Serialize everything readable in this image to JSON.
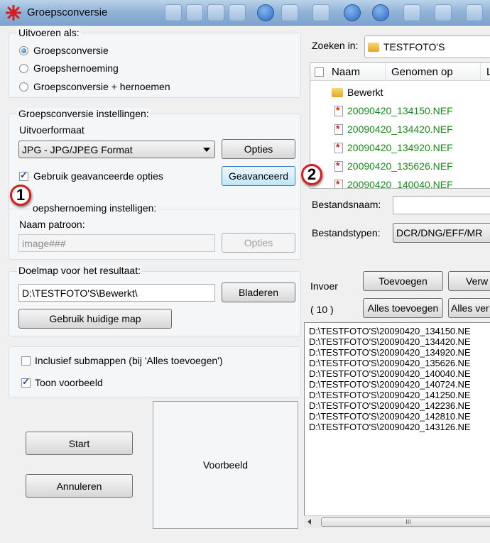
{
  "window": {
    "title": "Groepsconversie"
  },
  "output_as": {
    "legend": "Uitvoeren als:",
    "options": [
      "Groepsconversie",
      "Groepshernoeming",
      "Groepsconversie + hernoemen"
    ],
    "selected": 0
  },
  "conversion_settings": {
    "legend": "Groepsconversie instellingen:",
    "format_label": "Uitvoerformaat",
    "format_value": "JPG - JPG/JPEG Format",
    "options_button": "Opties",
    "advanced_checkbox": "Gebruik geavanceerde opties",
    "advanced_checked": true,
    "advanced_button": "Geavanceerd"
  },
  "rename_settings": {
    "legend": "oepshernoeming instelligen:",
    "pattern_label": "Naam patroon:",
    "pattern_value": "image###",
    "options_button": "Opties"
  },
  "target": {
    "legend": "Doelmap voor het resultaat:",
    "path": "D:\\TESTFOTO'S\\Bewerkt\\",
    "browse_button": "Bladeren",
    "current_button": "Gebruik huidige map"
  },
  "extra": {
    "subfolders_label": "Inclusief submappen (bij 'Alles toevoegen')",
    "subfolders_checked": false,
    "preview_label": "Toon voorbeeld",
    "preview_checked": true
  },
  "actions": {
    "start": "Start",
    "cancel": "Annuleren"
  },
  "preview_box": "Voorbeeld",
  "annotations": {
    "one": "1",
    "two": "2"
  },
  "browser": {
    "lookin_label": "Zoeken in:",
    "lookin_value": "TESTFOTO'S",
    "columns": [
      "Naam",
      "Genomen op",
      "L"
    ],
    "folder": "Bewerkt",
    "files": [
      "20090420_134150.NEF",
      "20090420_134420.NEF",
      "20090420_134920.NEF",
      "20090420_135626.NEF",
      "20090420_140040.NEF"
    ],
    "filename_label": "Bestandsnaam:",
    "filename_value": "",
    "filetypes_label": "Bestandstypen:",
    "filetypes_value": "DCR/DNG/EFF/MR"
  },
  "input": {
    "label": "Invoer",
    "count": "( 10 )",
    "add_button": "Toevoegen",
    "remove_button": "Verw",
    "add_all_button": "Alles toevoegen",
    "remove_all_button": "Alles ver",
    "items": [
      "D:\\TESTFOTO'S\\20090420_134150.NE",
      "D:\\TESTFOTO'S\\20090420_134420.NE",
      "D:\\TESTFOTO'S\\20090420_134920.NE",
      "D:\\TESTFOTO'S\\20090420_135626.NE",
      "D:\\TESTFOTO'S\\20090420_140040.NE",
      "D:\\TESTFOTO'S\\20090420_140724.NE",
      "D:\\TESTFOTO'S\\20090420_141250.NE",
      "D:\\TESTFOTO'S\\20090420_142236.NE",
      "D:\\TESTFOTO'S\\20090420_142810.NE",
      "D:\\TESTFOTO'S\\20090420_143126.NE"
    ],
    "scroll_grip": "III"
  },
  "colors": {
    "annotation_ring": "#d51d1d",
    "file_green": "#1a8a1a"
  }
}
